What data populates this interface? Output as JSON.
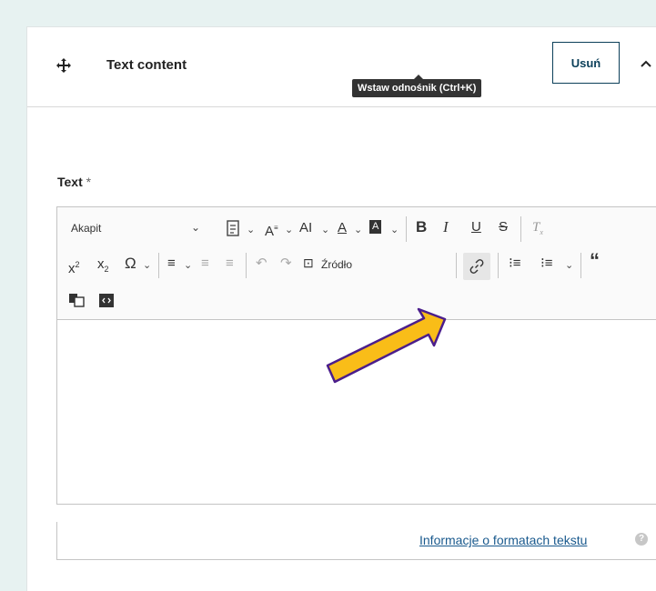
{
  "header": {
    "title": "Text content",
    "remove_label": "Usuń"
  },
  "field": {
    "label": "Text",
    "required_mark": "*"
  },
  "toolbar": {
    "paragraph_value": "Akapit",
    "source_label": "Źródło",
    "link_tooltip": "Wstaw odnośnik (Ctrl+K)",
    "buttons": [
      "bold",
      "italic",
      "underline",
      "strikethrough",
      "remove-format",
      "superscript",
      "subscript",
      "special-characters",
      "alignment",
      "outdent",
      "indent",
      "undo",
      "redo",
      "source",
      "link",
      "bulleted-list",
      "numbered-list",
      "blockquote",
      "paste-from-office",
      "embed"
    ]
  },
  "footer": {
    "formats_link": "Informacje o formatach tekstu"
  },
  "colors": {
    "accent": "#0b3f59",
    "highlight_arrow": "#f9bd18",
    "arrow_outline": "#4b1e8c"
  }
}
